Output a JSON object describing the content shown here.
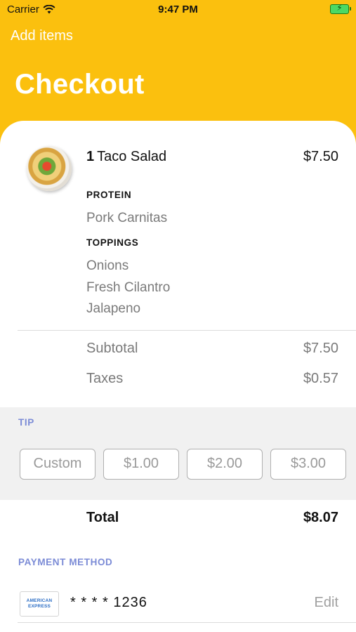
{
  "status_bar": {
    "carrier": "Carrier",
    "time": "9:47 PM",
    "battery_icon": "battery-charging-icon"
  },
  "nav": {
    "back_label": "Add items",
    "title": "Checkout"
  },
  "colors": {
    "header": "#FBC00E",
    "tip_background": "#F1F1F1",
    "section_label": "#7B8BD6"
  },
  "item": {
    "quantity": "1",
    "name": "Taco Salad",
    "price": "$7.50",
    "options": [
      {
        "heading": "PROTEIN",
        "values": [
          "Pork Carnitas"
        ]
      },
      {
        "heading": "TOPPINGS",
        "values": [
          "Onions",
          "Fresh Cilantro",
          "Jalapeno"
        ]
      }
    ]
  },
  "summary": {
    "subtotal_label": "Subtotal",
    "subtotal_value": "$7.50",
    "taxes_label": "Taxes",
    "taxes_value": "$0.57"
  },
  "tip": {
    "label": "TIP",
    "options": [
      "Custom",
      "$1.00",
      "$2.00",
      "$3.00"
    ]
  },
  "total": {
    "label": "Total",
    "value": "$8.07"
  },
  "payment": {
    "label": "PAYMENT METHOD",
    "card_logo_line1": "AMERICAN",
    "card_logo_line2": "EXPRESS",
    "card_number": "* * * * 1236",
    "edit_label": "Edit"
  }
}
